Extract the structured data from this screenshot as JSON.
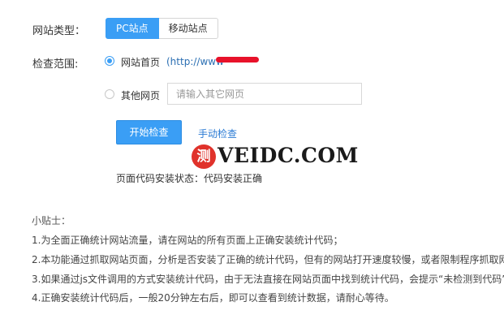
{
  "site_type": {
    "label": "网站类型：",
    "options": [
      "PC站点",
      "移动站点"
    ],
    "selected": "PC站点"
  },
  "scope": {
    "label": "检查范围:",
    "homepage": {
      "label": "网站首页",
      "url": "(http://www"
    },
    "other": {
      "label": "其他网页",
      "placeholder": "请输入其它网页"
    }
  },
  "actions": {
    "start_label": "开始检查",
    "manual_label": "手动检查"
  },
  "watermark": {
    "logo_char": "测",
    "text": "VEIDC.COM"
  },
  "status_text": "页面代码安装状态：代码安装正确",
  "tips": {
    "title": "小贴士：",
    "items": [
      "1.为全面正确统计网站流量，请在网站的所有页面上正确安装统计代码；",
      "2.本功能通过抓取网站页面，分析是否安装了正确的统计代码，但有的网站打开速度较慢，或者限制程序抓取网",
      "3.如果通过js文件调用的方式安装统计代码，由于无法直接在网站页面中找到统计代码，会提示“未检测到代码”",
      "4.正确安装统计代码后，一般20分钟左右后，即可以查看到统计数据，请耐心等待。"
    ]
  },
  "colors": {
    "accent": "#3a9ef5",
    "link": "#2b7bd4",
    "redact": "#e8122a"
  }
}
